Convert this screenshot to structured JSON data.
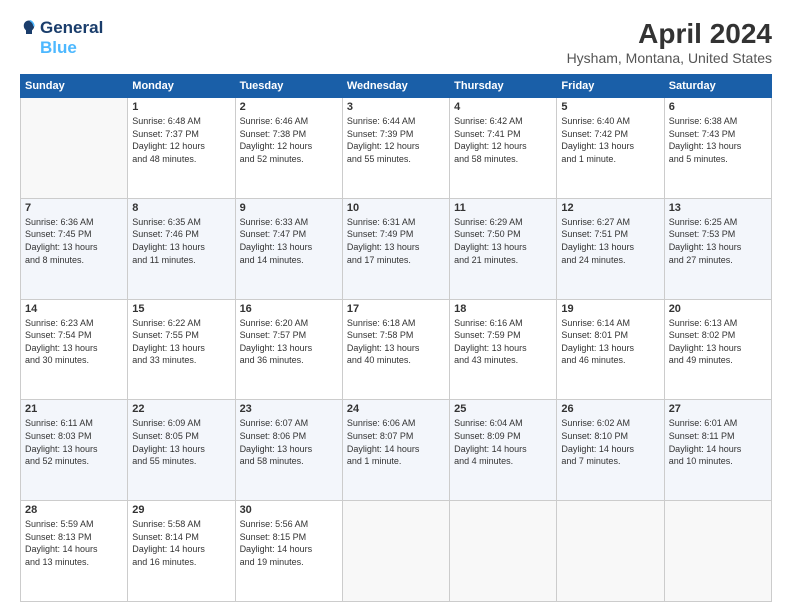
{
  "logo": {
    "line1": "General",
    "line2": "Blue"
  },
  "title": "April 2024",
  "subtitle": "Hysham, Montana, United States",
  "days_of_week": [
    "Sunday",
    "Monday",
    "Tuesday",
    "Wednesday",
    "Thursday",
    "Friday",
    "Saturday"
  ],
  "weeks": [
    [
      {
        "day": "",
        "info": ""
      },
      {
        "day": "1",
        "info": "Sunrise: 6:48 AM\nSunset: 7:37 PM\nDaylight: 12 hours\nand 48 minutes."
      },
      {
        "day": "2",
        "info": "Sunrise: 6:46 AM\nSunset: 7:38 PM\nDaylight: 12 hours\nand 52 minutes."
      },
      {
        "day": "3",
        "info": "Sunrise: 6:44 AM\nSunset: 7:39 PM\nDaylight: 12 hours\nand 55 minutes."
      },
      {
        "day": "4",
        "info": "Sunrise: 6:42 AM\nSunset: 7:41 PM\nDaylight: 12 hours\nand 58 minutes."
      },
      {
        "day": "5",
        "info": "Sunrise: 6:40 AM\nSunset: 7:42 PM\nDaylight: 13 hours\nand 1 minute."
      },
      {
        "day": "6",
        "info": "Sunrise: 6:38 AM\nSunset: 7:43 PM\nDaylight: 13 hours\nand 5 minutes."
      }
    ],
    [
      {
        "day": "7",
        "info": "Sunrise: 6:36 AM\nSunset: 7:45 PM\nDaylight: 13 hours\nand 8 minutes."
      },
      {
        "day": "8",
        "info": "Sunrise: 6:35 AM\nSunset: 7:46 PM\nDaylight: 13 hours\nand 11 minutes."
      },
      {
        "day": "9",
        "info": "Sunrise: 6:33 AM\nSunset: 7:47 PM\nDaylight: 13 hours\nand 14 minutes."
      },
      {
        "day": "10",
        "info": "Sunrise: 6:31 AM\nSunset: 7:49 PM\nDaylight: 13 hours\nand 17 minutes."
      },
      {
        "day": "11",
        "info": "Sunrise: 6:29 AM\nSunset: 7:50 PM\nDaylight: 13 hours\nand 21 minutes."
      },
      {
        "day": "12",
        "info": "Sunrise: 6:27 AM\nSunset: 7:51 PM\nDaylight: 13 hours\nand 24 minutes."
      },
      {
        "day": "13",
        "info": "Sunrise: 6:25 AM\nSunset: 7:53 PM\nDaylight: 13 hours\nand 27 minutes."
      }
    ],
    [
      {
        "day": "14",
        "info": "Sunrise: 6:23 AM\nSunset: 7:54 PM\nDaylight: 13 hours\nand 30 minutes."
      },
      {
        "day": "15",
        "info": "Sunrise: 6:22 AM\nSunset: 7:55 PM\nDaylight: 13 hours\nand 33 minutes."
      },
      {
        "day": "16",
        "info": "Sunrise: 6:20 AM\nSunset: 7:57 PM\nDaylight: 13 hours\nand 36 minutes."
      },
      {
        "day": "17",
        "info": "Sunrise: 6:18 AM\nSunset: 7:58 PM\nDaylight: 13 hours\nand 40 minutes."
      },
      {
        "day": "18",
        "info": "Sunrise: 6:16 AM\nSunset: 7:59 PM\nDaylight: 13 hours\nand 43 minutes."
      },
      {
        "day": "19",
        "info": "Sunrise: 6:14 AM\nSunset: 8:01 PM\nDaylight: 13 hours\nand 46 minutes."
      },
      {
        "day": "20",
        "info": "Sunrise: 6:13 AM\nSunset: 8:02 PM\nDaylight: 13 hours\nand 49 minutes."
      }
    ],
    [
      {
        "day": "21",
        "info": "Sunrise: 6:11 AM\nSunset: 8:03 PM\nDaylight: 13 hours\nand 52 minutes."
      },
      {
        "day": "22",
        "info": "Sunrise: 6:09 AM\nSunset: 8:05 PM\nDaylight: 13 hours\nand 55 minutes."
      },
      {
        "day": "23",
        "info": "Sunrise: 6:07 AM\nSunset: 8:06 PM\nDaylight: 13 hours\nand 58 minutes."
      },
      {
        "day": "24",
        "info": "Sunrise: 6:06 AM\nSunset: 8:07 PM\nDaylight: 14 hours\nand 1 minute."
      },
      {
        "day": "25",
        "info": "Sunrise: 6:04 AM\nSunset: 8:09 PM\nDaylight: 14 hours\nand 4 minutes."
      },
      {
        "day": "26",
        "info": "Sunrise: 6:02 AM\nSunset: 8:10 PM\nDaylight: 14 hours\nand 7 minutes."
      },
      {
        "day": "27",
        "info": "Sunrise: 6:01 AM\nSunset: 8:11 PM\nDaylight: 14 hours\nand 10 minutes."
      }
    ],
    [
      {
        "day": "28",
        "info": "Sunrise: 5:59 AM\nSunset: 8:13 PM\nDaylight: 14 hours\nand 13 minutes."
      },
      {
        "day": "29",
        "info": "Sunrise: 5:58 AM\nSunset: 8:14 PM\nDaylight: 14 hours\nand 16 minutes."
      },
      {
        "day": "30",
        "info": "Sunrise: 5:56 AM\nSunset: 8:15 PM\nDaylight: 14 hours\nand 19 minutes."
      },
      {
        "day": "",
        "info": ""
      },
      {
        "day": "",
        "info": ""
      },
      {
        "day": "",
        "info": ""
      },
      {
        "day": "",
        "info": ""
      }
    ]
  ]
}
